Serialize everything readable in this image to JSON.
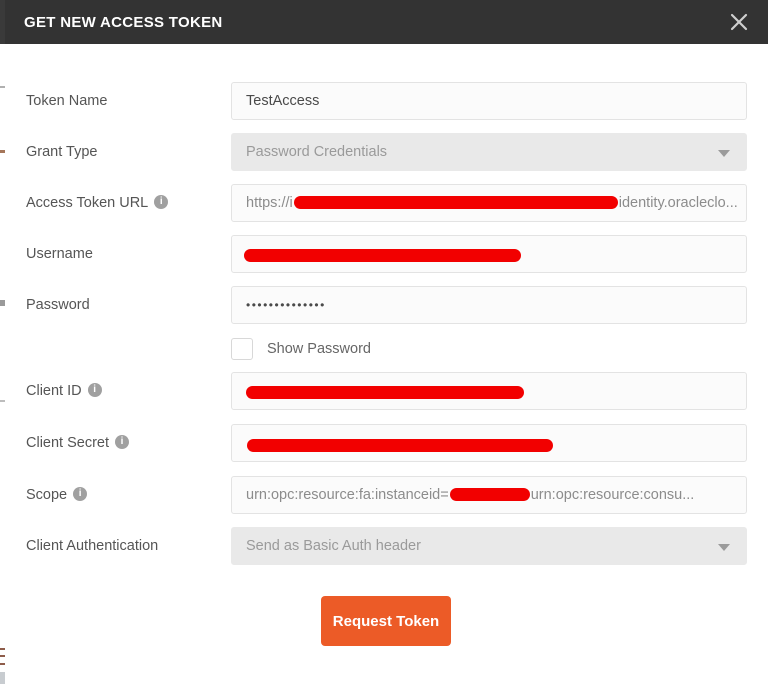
{
  "header": {
    "title": "GET NEW ACCESS TOKEN",
    "close_icon": "close-icon"
  },
  "colors": {
    "header_bg": "#333333",
    "accent_button": "#ec5b27",
    "redaction": "#f20000",
    "field_border": "#e3e3e3",
    "dropdown_bg": "#e9e9e9"
  },
  "form": {
    "token_name": {
      "label": "Token Name",
      "value": "TestAccess",
      "type": "text"
    },
    "grant_type": {
      "label": "Grant Type",
      "value": "Password Credentials",
      "type": "select",
      "caret_icon": "chevron-down-icon"
    },
    "access_token_url": {
      "label": "Access Token URL",
      "info_icon": "info-icon",
      "value_prefix": "https://i",
      "value_suffix": "identity.oracleclo...",
      "type": "text"
    },
    "username": {
      "label": "Username",
      "value": "",
      "type": "text"
    },
    "password": {
      "label": "Password",
      "value": "••••••••••••••",
      "type": "password"
    },
    "show_password": {
      "label": "Show Password",
      "checked": false
    },
    "client_id": {
      "label": "Client ID",
      "info_icon": "info-icon",
      "value": "",
      "type": "text"
    },
    "client_secret": {
      "label": "Client Secret",
      "info_icon": "info-icon",
      "value": "",
      "type": "text"
    },
    "scope": {
      "label": "Scope",
      "info_icon": "info-icon",
      "value_prefix": "urn:opc:resource:fa:instanceid=",
      "value_suffix": "urn:opc:resource:consu...",
      "type": "text"
    },
    "client_authentication": {
      "label": "Client Authentication",
      "value": "Send as Basic Auth header",
      "type": "select",
      "caret_icon": "chevron-down-icon"
    }
  },
  "actions": {
    "request_token": "Request Token"
  }
}
